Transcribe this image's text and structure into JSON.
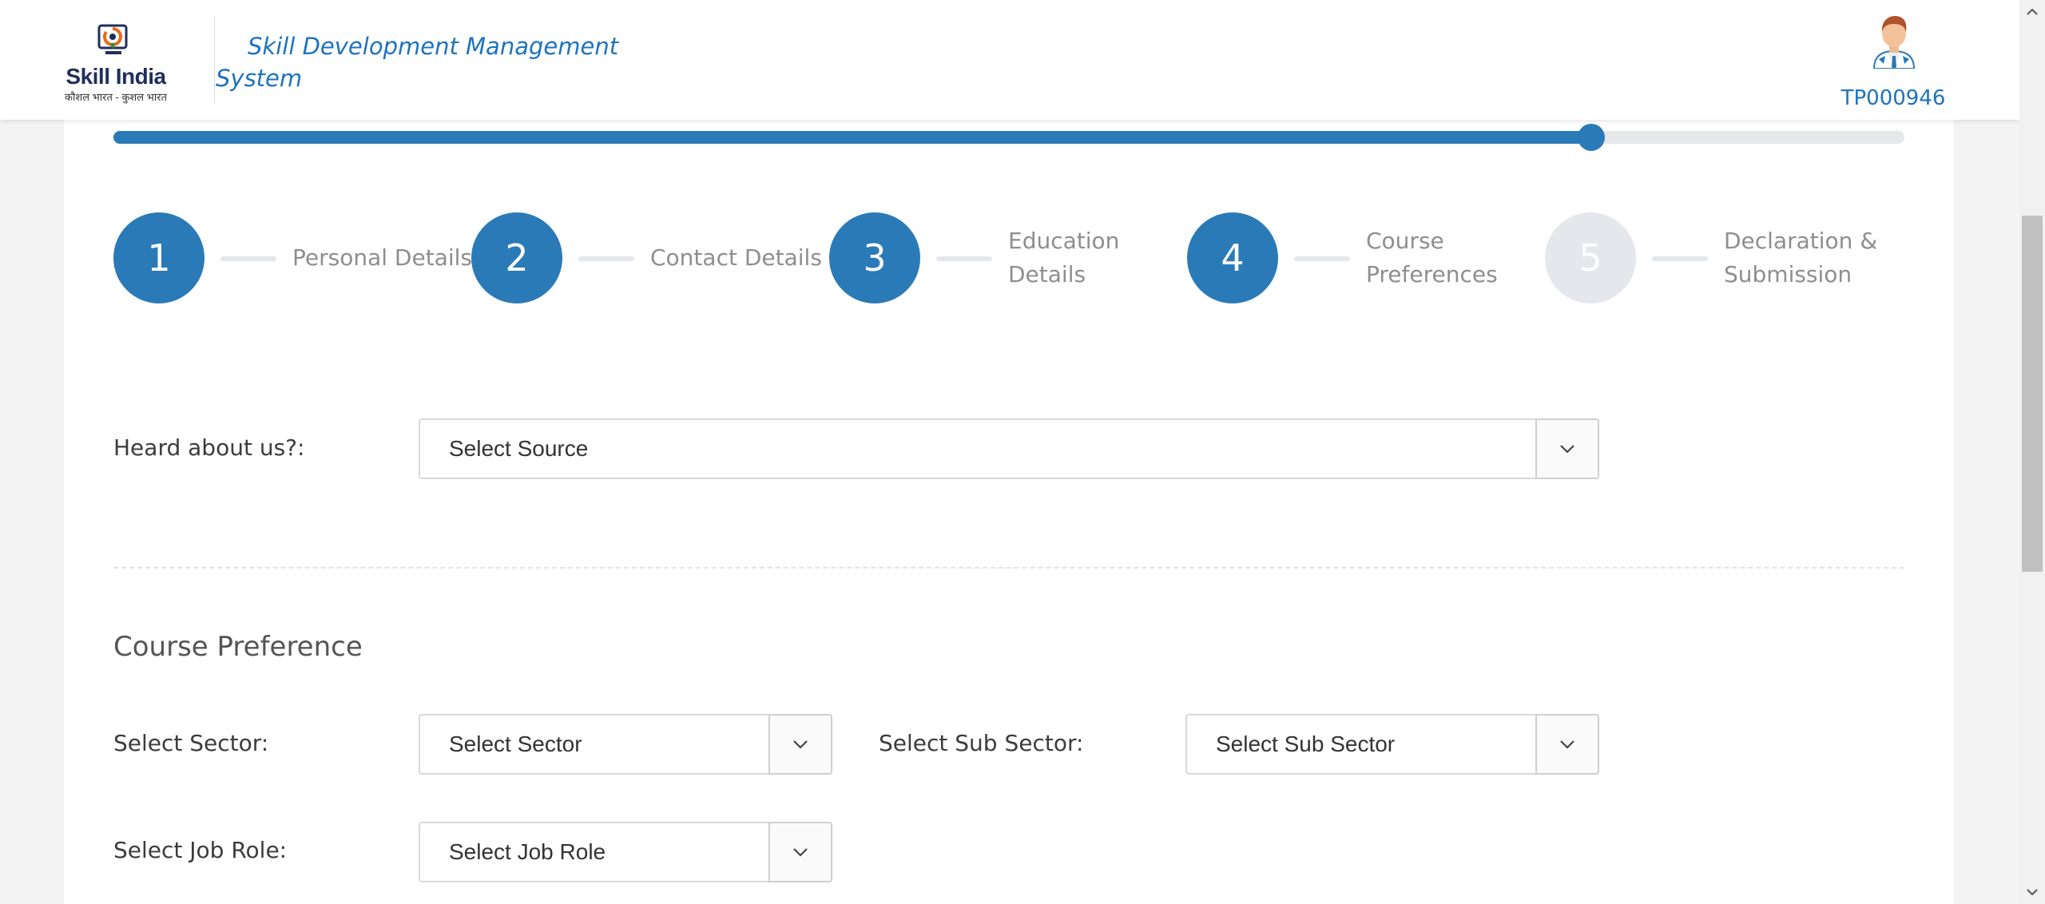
{
  "header": {
    "logo_brand": "Skill India",
    "logo_tagline": "कौशल भारत - कुशल भारत",
    "system_title": "Skill Development Management System",
    "user_id": "TP000946"
  },
  "progress": {
    "percent": 82.5
  },
  "steps": [
    {
      "number": "1",
      "label": "Personal Details",
      "state": "complete"
    },
    {
      "number": "2",
      "label": "Contact Details",
      "state": "complete"
    },
    {
      "number": "3",
      "label": "Education Details",
      "state": "complete"
    },
    {
      "number": "4",
      "label": "Course Preferences",
      "state": "current"
    },
    {
      "number": "5",
      "label": "Declaration & Submission",
      "state": "pending"
    }
  ],
  "form": {
    "heard_about": {
      "label": "Heard about us?:",
      "value": "Select Source"
    },
    "section_title": "Course Preference",
    "sector": {
      "label": "Select Sector:",
      "value": "Select Sector"
    },
    "sub_sector": {
      "label": "Select Sub Sector:",
      "value": "Select Sub Sector"
    },
    "job_role": {
      "label": "Select Job Role:",
      "value": "Select Job Role"
    }
  },
  "colors": {
    "primary": "#2a7ab8",
    "link_blue": "#1e73be",
    "inactive": "#e4e7ec"
  },
  "icons": {
    "dropdown": "chevron-down-icon",
    "avatar": "user-avatar-icon",
    "logo": "skill-india-logo"
  }
}
